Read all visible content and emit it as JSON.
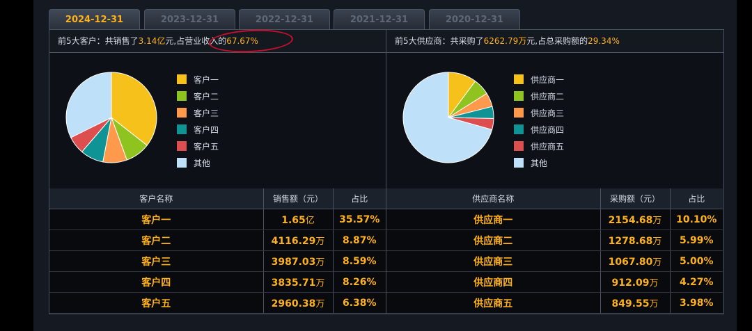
{
  "tabs": [
    "2024-12-31",
    "2023-12-31",
    "2022-12-31",
    "2021-12-31",
    "2020-12-31"
  ],
  "active_tab": 0,
  "customers": {
    "summary": {
      "prefix": "前5大客户：共销售了",
      "amount": "3.14亿",
      "mid": "元,占营业收入的",
      "ratio": "67.67%"
    },
    "legend": [
      "客户一",
      "客户二",
      "客户三",
      "客户四",
      "客户五",
      "其他"
    ],
    "headers": [
      "客户名称",
      "销售额（元）",
      "占比"
    ],
    "rows": [
      {
        "name": "客户一",
        "amount": "1.65",
        "unit": "亿",
        "pct": "35.57%"
      },
      {
        "name": "客户二",
        "amount": "4116.29",
        "unit": "万",
        "pct": "8.87%"
      },
      {
        "name": "客户三",
        "amount": "3987.03",
        "unit": "万",
        "pct": "8.59%"
      },
      {
        "name": "客户四",
        "amount": "3835.71",
        "unit": "万",
        "pct": "8.26%"
      },
      {
        "name": "客户五",
        "amount": "2960.38",
        "unit": "万",
        "pct": "6.38%"
      }
    ],
    "shares": [
      35.57,
      8.87,
      8.59,
      8.26,
      6.38,
      32.33
    ]
  },
  "suppliers": {
    "summary": {
      "prefix": "前5大供应商：共采购了",
      "amount": "6262.79万",
      "mid": "元,占总采购额的",
      "ratio": "29.34%"
    },
    "legend": [
      "供应商一",
      "供应商二",
      "供应商三",
      "供应商四",
      "供应商五",
      "其他"
    ],
    "headers": [
      "供应商名称",
      "采购额（元）",
      "占比"
    ],
    "rows": [
      {
        "name": "供应商一",
        "amount": "2154.68",
        "unit": "万",
        "pct": "10.10%"
      },
      {
        "name": "供应商二",
        "amount": "1278.68",
        "unit": "万",
        "pct": "5.99%"
      },
      {
        "name": "供应商三",
        "amount": "1067.80",
        "unit": "万",
        "pct": "5.00%"
      },
      {
        "name": "供应商四",
        "amount": "912.09",
        "unit": "万",
        "pct": "4.27%"
      },
      {
        "name": "供应商五",
        "amount": "849.55",
        "unit": "万",
        "pct": "3.98%"
      }
    ],
    "shares": [
      10.1,
      5.99,
      5.0,
      4.27,
      3.98,
      70.66
    ]
  },
  "colors": {
    "slices": [
      "#f5c11a",
      "#8fc31f",
      "#ff9a4d",
      "#0f9394",
      "#dd4e4e",
      "#bfe0f9"
    ],
    "accent": "#ffb11b",
    "annotation": "#c8102e"
  }
}
